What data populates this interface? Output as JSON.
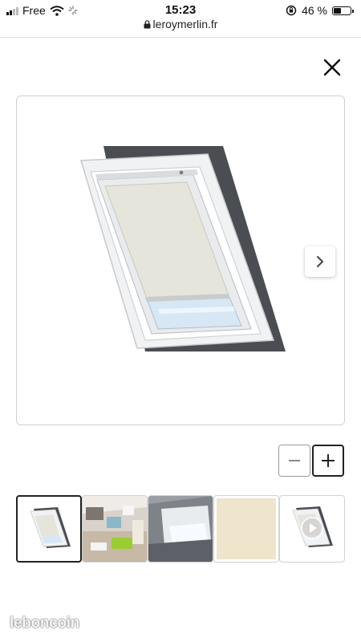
{
  "status_bar": {
    "carrier": "Free",
    "time": "15:23",
    "battery_percent": "46 %",
    "battery_level": 0.46
  },
  "browser": {
    "url": "leroymerlin.fr"
  },
  "gallery": {
    "current_index": 0,
    "thumbnails": [
      {
        "name": "thumb-blind-white",
        "kind": "product-blind"
      },
      {
        "name": "thumb-room-interior",
        "kind": "room-photo"
      },
      {
        "name": "thumb-window-closeup",
        "kind": "window-photo"
      },
      {
        "name": "thumb-color-swatch",
        "kind": "swatch",
        "color": "#efe4cc"
      },
      {
        "name": "thumb-video",
        "kind": "video"
      }
    ]
  },
  "icons": {
    "close": "close-icon",
    "next": "chevron-right-icon",
    "zoom_out": "minus-icon",
    "zoom_in": "plus-icon",
    "play": "play-icon",
    "lock": "lock-icon"
  },
  "watermark": {
    "text": "leboncoin"
  }
}
